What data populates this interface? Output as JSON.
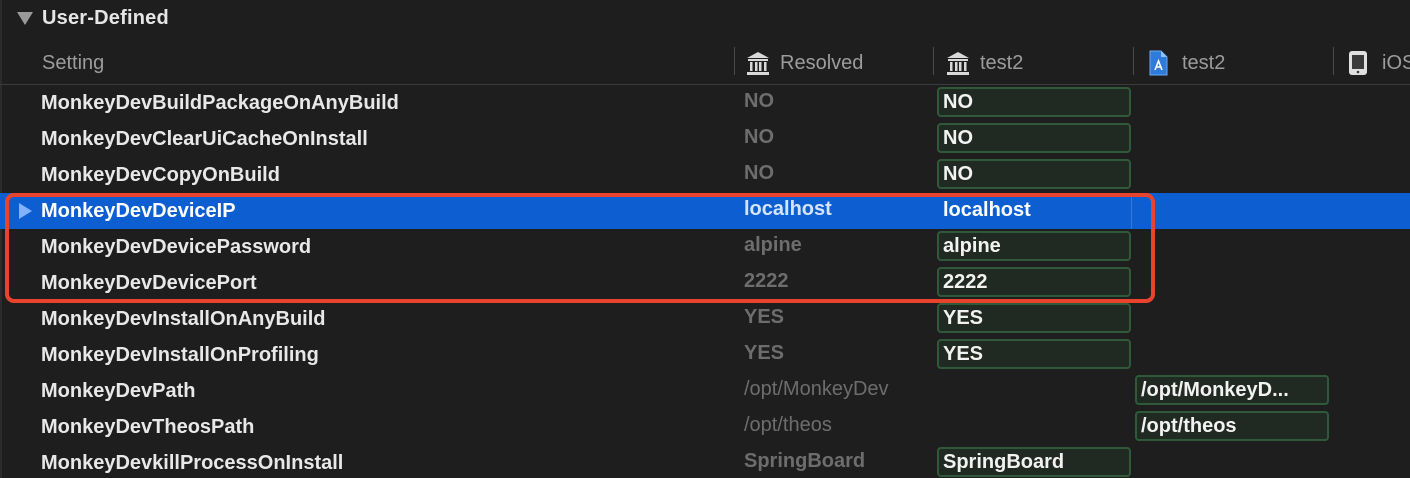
{
  "section": {
    "title": "User-Defined"
  },
  "columns": {
    "setting": "Setting",
    "resolved": "Resolved",
    "project": "test2",
    "target": "test2",
    "platform": "iOS"
  },
  "rows": [
    {
      "name": "MonkeyDevBuildPackageOnAnyBuild",
      "resolved": "NO",
      "project_value": "NO",
      "target_value": ""
    },
    {
      "name": "MonkeyDevClearUiCacheOnInstall",
      "resolved": "NO",
      "project_value": "NO",
      "target_value": ""
    },
    {
      "name": "MonkeyDevCopyOnBuild",
      "resolved": "NO",
      "project_value": "NO",
      "target_value": ""
    },
    {
      "name": "MonkeyDevDeviceIP",
      "resolved": "localhost",
      "project_value": "localhost",
      "target_value": "",
      "selected": true
    },
    {
      "name": "MonkeyDevDevicePassword",
      "resolved": "alpine",
      "project_value": "alpine",
      "target_value": ""
    },
    {
      "name": "MonkeyDevDevicePort",
      "resolved": "2222",
      "project_value": "2222",
      "target_value": ""
    },
    {
      "name": "MonkeyDevInstallOnAnyBuild",
      "resolved": "YES",
      "project_value": "YES",
      "target_value": ""
    },
    {
      "name": "MonkeyDevInstallOnProfiling",
      "resolved": "YES",
      "project_value": "YES",
      "target_value": ""
    },
    {
      "name": "MonkeyDevPath",
      "resolved": "/opt/MonkeyDev",
      "project_value": "",
      "target_value": "/opt/MonkeyD..."
    },
    {
      "name": "MonkeyDevTheosPath",
      "resolved": "/opt/theos",
      "project_value": "",
      "target_value": "/opt/theos"
    },
    {
      "name": "MonkeyDevkillProcessOnInstall",
      "resolved": "SpringBoard",
      "project_value": "SpringBoard",
      "target_value": ""
    }
  ],
  "colors": {
    "background": "#1e1e1e",
    "selection": "#0d5fd1",
    "highlight_outline": "#e8432d",
    "value_box_border": "#2f5a3a"
  },
  "icons": {
    "project_column": "project-building-icon",
    "target_column": "app-document-icon",
    "platform_column": "device-icon"
  }
}
